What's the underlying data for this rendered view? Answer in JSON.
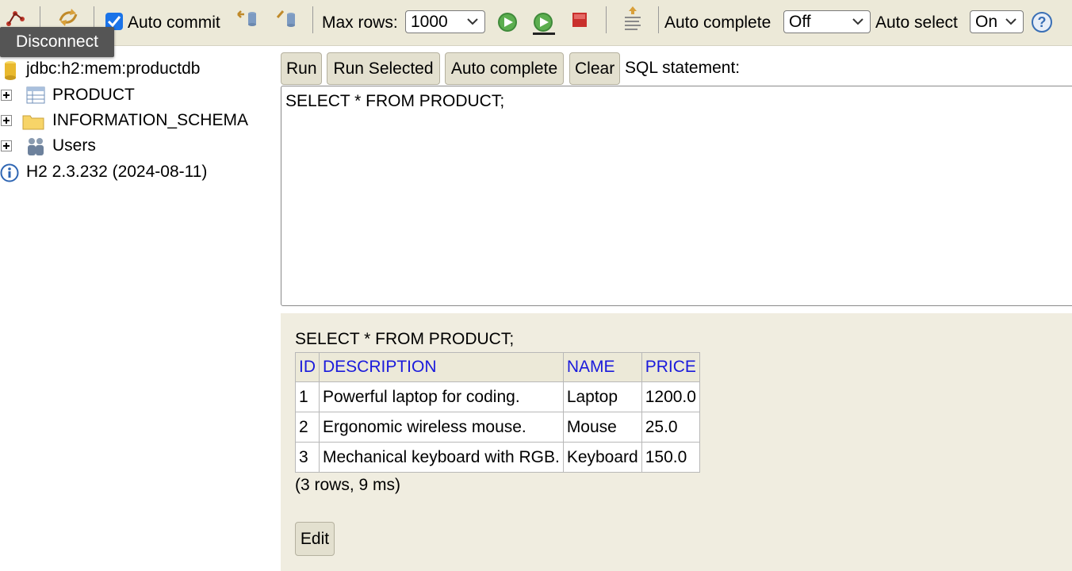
{
  "toolbar": {
    "disconnect_tooltip": "Disconnect",
    "auto_commit_label": "Auto commit",
    "auto_commit_checked": true,
    "max_rows_label": "Max rows:",
    "max_rows_value": "1000",
    "auto_complete_label": "Auto complete",
    "auto_complete_value": "Off",
    "auto_select_label": "Auto select",
    "auto_select_value": "On",
    "icons": [
      "disconnect-icon",
      "refresh-icon",
      "rollback-icon",
      "commit-icon",
      "run-icon",
      "run-selected-icon",
      "stop-icon",
      "history-icon",
      "help-icon"
    ]
  },
  "tree": {
    "connection": "jdbc:h2:mem:productdb",
    "items": [
      {
        "label": "PRODUCT",
        "icon": "table-icon"
      },
      {
        "label": "INFORMATION_SCHEMA",
        "icon": "folder-icon"
      },
      {
        "label": "Users",
        "icon": "users-icon"
      }
    ],
    "version": "H2 2.3.232 (2024-08-11)"
  },
  "query": {
    "buttons": {
      "run": "Run",
      "run_selected": "Run Selected",
      "auto_complete": "Auto complete",
      "clear": "Clear"
    },
    "sql_label": "SQL statement:",
    "sql_text": "SELECT * FROM PRODUCT;"
  },
  "result": {
    "query": "SELECT * FROM PRODUCT;",
    "columns": [
      "ID",
      "DESCRIPTION",
      "NAME",
      "PRICE"
    ],
    "rows": [
      [
        "1",
        "Powerful laptop for coding.",
        "Laptop",
        "1200.0"
      ],
      [
        "2",
        "Ergonomic wireless mouse.",
        "Mouse",
        "25.0"
      ],
      [
        "3",
        "Mechanical keyboard with RGB.",
        "Keyboard",
        "150.0"
      ]
    ],
    "status": "(3 rows, 9 ms)",
    "edit_label": "Edit"
  },
  "colors": {
    "toolbar_bg": "#ece9d8",
    "result_bg": "#f0ede0",
    "header_link": "#1a1adc",
    "checkbox": "#1a73e8"
  }
}
